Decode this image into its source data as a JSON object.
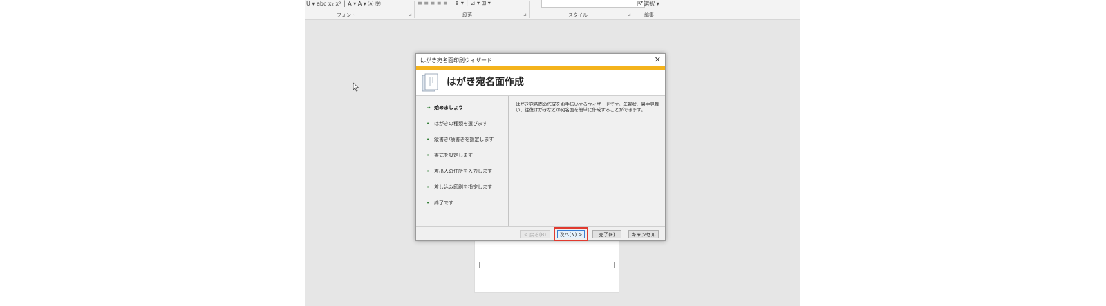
{
  "ribbon": {
    "font_tools": "U ▾  abc  x₂  x²  │  A ▾  A ▾  Ⓐ  ㊫",
    "para_tools": "≡  ≡  ≡  ≡  ≡  │  ↕ ▾  │  ⊿ ▾  ⊞ ▾",
    "edit_select": "選択 ▾",
    "group_font": "フォント",
    "group_paragraph": "段落",
    "group_style": "スタイル",
    "group_edit": "編集",
    "launcher": "⊿"
  },
  "dialog": {
    "title": "はがき宛名面印刷ウィザード",
    "close": "✕",
    "header": "はがき宛名面作成",
    "steps": [
      {
        "label": "始めましょう",
        "marker": "➔"
      },
      {
        "label": "はがきの種類を選びます",
        "marker": "•"
      },
      {
        "label": "縦書き/横書きを指定します",
        "marker": "•"
      },
      {
        "label": "書式を設定します",
        "marker": "•"
      },
      {
        "label": "差出人の住所を入力します",
        "marker": "•"
      },
      {
        "label": "差し込み印刷を指定します",
        "marker": "•"
      },
      {
        "label": "終了です",
        "marker": "•"
      }
    ],
    "description": "はがき宛名面の作成をお手伝いするウィザードです。年賀状、暑中見舞い、往復はがきなどの宛名面を簡単に作成することができます。",
    "buttons": {
      "back": "< 戻る(B)",
      "next": "次へ(N) >",
      "finish": "完了(F)",
      "cancel": "キャンセル"
    }
  },
  "colors": {
    "accent": "#f4b31c",
    "highlight": "#e03a2f",
    "step_marker": "#2e7d32"
  }
}
